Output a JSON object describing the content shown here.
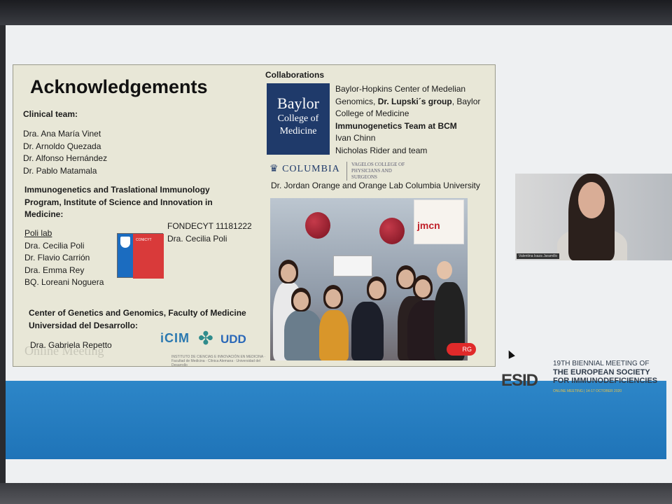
{
  "slide": {
    "title": "Acknowledgements",
    "clinical_team": {
      "heading": "Clinical team:",
      "members": [
        "Dra. Ana María Vinet",
        "Dr. Arnoldo Quezada",
        "Dr. Alfonso Hernández",
        "Dr. Pablo Matamala"
      ]
    },
    "program": {
      "heading_lines": [
        "Immunogenetics and Traslational Immunology",
        "Program, Institute of Science and Innovation in",
        "Medicine:"
      ],
      "lab_name": "Poli lab",
      "members": [
        "Dra. Cecilia Poli",
        "Dr. Flavio Carrión",
        "Dra. Emma Rey",
        "BQ. Loreani Noguera"
      ]
    },
    "fondecyt": {
      "grant": "FONDECYT 11181222",
      "pi": "Dra. Cecilia Poli",
      "logo_text": "CONICYT"
    },
    "center": {
      "heading_lines": [
        "Center of Genetics and Genomics, Faculty of Medicine",
        "Universidad del Desarrollo:"
      ],
      "member": "Dra. Gabriela Repetto",
      "logo_icim": "iCIM",
      "logo_udd": "UDD",
      "logo_sub": "INSTITUTO DE CIENCIAS E INNOVACIÓN EN MEDICINA · Facultad de Medicina · Clínica Alemana · Universidad del Desarrollo"
    },
    "watermark": "Online Meeting",
    "collaborations": {
      "heading": "Collaborations",
      "baylor_logo": [
        "Baylor",
        "College of",
        "Medicine"
      ],
      "baylor_text": [
        "Baylor-Hopkins Center of Medelian",
        "Genomics, ",
        "Dr. Lupski´s group",
        ", Baylor",
        "College of Medicine"
      ],
      "bcm_team": "Immunogenetics Team at BCM",
      "bcm_members": [
        "Ivan Chinn",
        "Nicholas Rider and team"
      ],
      "columbia_logo": "COLUMBIA",
      "vagelos": "VAGELOS COLLEGE OF PHYSICIANS AND SURGEONS",
      "columbia_text": "Dr. Jordan Orange and Orange Lab Columbia University",
      "jmcn": "jmcn",
      "red_label": "RG"
    }
  },
  "video": {
    "participant_name": "Valentina Isaza Jaramillo"
  },
  "esid": {
    "logo": "ESID",
    "meeting_line": "19TH BIENNIAL MEETING OF",
    "org_line1": "THE EUROPEAN SOCIETY",
    "org_line2": "FOR IMMUNODEFICIENCIES",
    "sub": "ONLINE MEETING | 14-17 OCTOBER 2020"
  },
  "colors": {
    "blue_band": "#1f74b8",
    "baylor_blue": "#1f3a6a",
    "fondecyt_red": "#d93a3a"
  }
}
